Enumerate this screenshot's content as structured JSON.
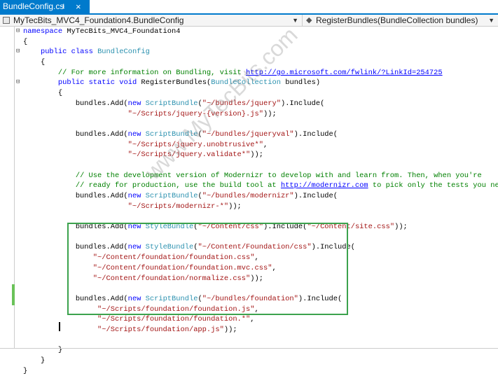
{
  "tab": {
    "title": "BundleConfig.cs",
    "pin_glyph": "⭳",
    "close_glyph": "×"
  },
  "navbar": {
    "type_dropdown": "MyTecBits_MVC4_Foundation4.BundleConfig",
    "member_dropdown": "RegisterBundles(BundleCollection bundles)"
  },
  "watermark": "www.MyTecBits.com",
  "code_lines": [
    [
      [
        "kw",
        "namespace"
      ],
      [
        "",
        " MyTecBits_MVC4_Foundation4"
      ]
    ],
    [
      [
        "",
        "{"
      ]
    ],
    [
      [
        "",
        "    "
      ],
      [
        "kw",
        "public"
      ],
      [
        "",
        " "
      ],
      [
        "kw",
        "class"
      ],
      [
        "",
        " "
      ],
      [
        "ty",
        "BundleConfig"
      ]
    ],
    [
      [
        "",
        "    {"
      ]
    ],
    [
      [
        "",
        "        "
      ],
      [
        "cm",
        "// For more information on Bundling, visit "
      ],
      [
        "lnk",
        "http://go.microsoft.com/fwlink/?LinkId=254725"
      ]
    ],
    [
      [
        "",
        "        "
      ],
      [
        "kw",
        "public"
      ],
      [
        "",
        " "
      ],
      [
        "kw",
        "static"
      ],
      [
        "",
        " "
      ],
      [
        "kw",
        "void"
      ],
      [
        "",
        " RegisterBundles("
      ],
      [
        "ty",
        "BundleCollection"
      ],
      [
        "",
        " bundles)"
      ]
    ],
    [
      [
        "",
        "        {"
      ]
    ],
    [
      [
        "",
        "            bundles.Add("
      ],
      [
        "kw",
        "new"
      ],
      [
        "",
        " "
      ],
      [
        "ty",
        "ScriptBundle"
      ],
      [
        "",
        "("
      ],
      [
        "str",
        "\"~/bundles/jquery\""
      ],
      [
        "",
        ").Include("
      ]
    ],
    [
      [
        "",
        "                        "
      ],
      [
        "str",
        "\"~/Scripts/jquery-{version}.js\""
      ],
      [
        "",
        "));"
      ]
    ],
    [
      [
        "",
        ""
      ]
    ],
    [
      [
        "",
        "            bundles.Add("
      ],
      [
        "kw",
        "new"
      ],
      [
        "",
        " "
      ],
      [
        "ty",
        "ScriptBundle"
      ],
      [
        "",
        "("
      ],
      [
        "str",
        "\"~/bundles/jqueryval\""
      ],
      [
        "",
        ").Include("
      ]
    ],
    [
      [
        "",
        "                        "
      ],
      [
        "str",
        "\"~/Scripts/jquery.unobtrusive*\""
      ],
      [
        "",
        ","
      ]
    ],
    [
      [
        "",
        "                        "
      ],
      [
        "str",
        "\"~/Scripts/jquery.validate*\""
      ],
      [
        "",
        "));"
      ]
    ],
    [
      [
        "",
        ""
      ]
    ],
    [
      [
        "",
        "            "
      ],
      [
        "cm",
        "// Use the development version of Modernizr to develop with and learn from. Then, when you're"
      ]
    ],
    [
      [
        "",
        "            "
      ],
      [
        "cm",
        "// ready for production, use the build tool at "
      ],
      [
        "lnk",
        "http://modernizr.com"
      ],
      [
        "cm",
        " to pick only the tests you need."
      ]
    ],
    [
      [
        "",
        "            bundles.Add("
      ],
      [
        "kw",
        "new"
      ],
      [
        "",
        " "
      ],
      [
        "ty",
        "ScriptBundle"
      ],
      [
        "",
        "("
      ],
      [
        "str",
        "\"~/bundles/modernizr\""
      ],
      [
        "",
        ").Include("
      ]
    ],
    [
      [
        "",
        "                        "
      ],
      [
        "str",
        "\"~/Scripts/modernizr-*\""
      ],
      [
        "",
        "));"
      ]
    ],
    [
      [
        "",
        ""
      ]
    ],
    [
      [
        "",
        "            bundles.Add("
      ],
      [
        "kw",
        "new"
      ],
      [
        "",
        " "
      ],
      [
        "ty",
        "StyleBundle"
      ],
      [
        "",
        "("
      ],
      [
        "str",
        "\"~/Content/css\""
      ],
      [
        "",
        ").Include("
      ],
      [
        "str",
        "\"~/Content/site.css\""
      ],
      [
        "",
        "));"
      ]
    ],
    [
      [
        "",
        ""
      ]
    ],
    [
      [
        "",
        "            bundles.Add("
      ],
      [
        "kw",
        "new"
      ],
      [
        "",
        " "
      ],
      [
        "ty",
        "StyleBundle"
      ],
      [
        "",
        "("
      ],
      [
        "str",
        "\"~/Content/Foundation/css\""
      ],
      [
        "",
        ").Include("
      ]
    ],
    [
      [
        "",
        "                "
      ],
      [
        "str",
        "\"~/Content/foundation/foundation.css\""
      ],
      [
        "",
        ","
      ]
    ],
    [
      [
        "",
        "                "
      ],
      [
        "str",
        "\"~/Content/foundation/foundation.mvc.css\""
      ],
      [
        "",
        ","
      ]
    ],
    [
      [
        "",
        "                "
      ],
      [
        "str",
        "\"~/Content/foundation/normalize.css\""
      ],
      [
        "",
        "));"
      ]
    ],
    [
      [
        "",
        ""
      ]
    ],
    [
      [
        "",
        "            bundles.Add("
      ],
      [
        "kw",
        "new"
      ],
      [
        "",
        " "
      ],
      [
        "ty",
        "ScriptBundle"
      ],
      [
        "",
        "("
      ],
      [
        "str",
        "\"~/bundles/foundation\""
      ],
      [
        "",
        ").Include("
      ]
    ],
    [
      [
        "",
        "                 "
      ],
      [
        "str",
        "\"~/Scripts/foundation/foundation.js\""
      ],
      [
        "",
        ","
      ]
    ],
    [
      [
        "",
        "                 "
      ],
      [
        "str",
        "\"~/Scripts/foundation/foundation.*\""
      ],
      [
        "",
        ","
      ]
    ],
    [
      [
        "",
        "                 "
      ],
      [
        "str",
        "\"~/Scripts/foundation/app.js\""
      ],
      [
        "",
        "));"
      ]
    ],
    [
      [
        "",
        ""
      ]
    ],
    [
      [
        "",
        "        }"
      ]
    ],
    [
      [
        "",
        "    }"
      ]
    ],
    [
      [
        "",
        "}"
      ]
    ]
  ]
}
